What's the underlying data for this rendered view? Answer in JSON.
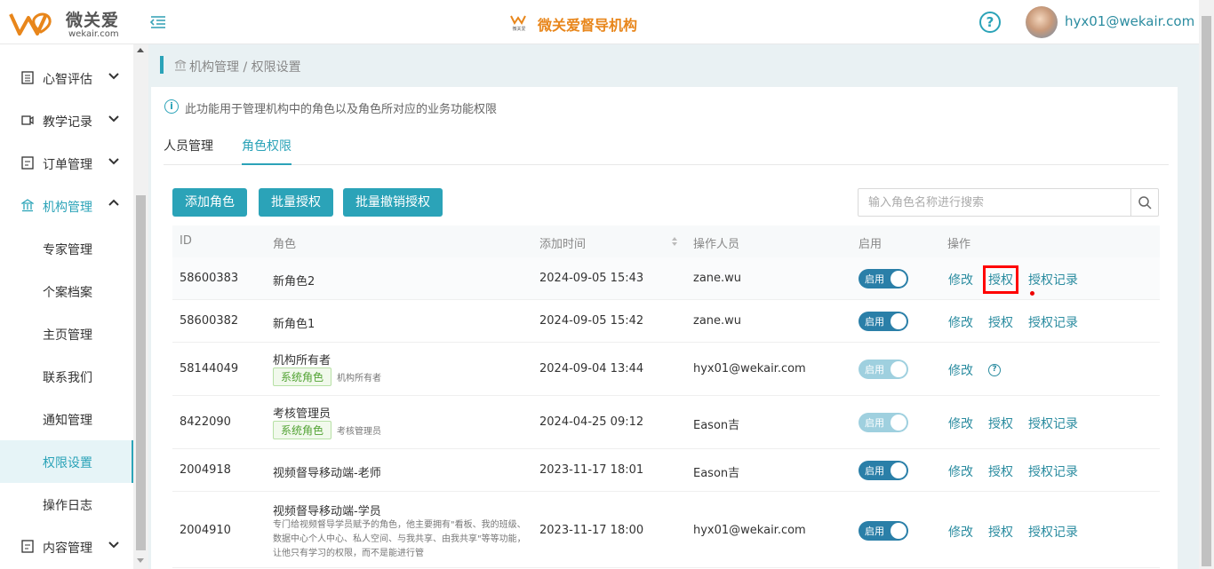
{
  "header": {
    "brand": "微关爱",
    "domain": "wekair.com",
    "mini_logo_text": "微关爱",
    "center_title": "微关爱督导机构",
    "help_glyph": "?",
    "user_email": "hyx01@wekair.com"
  },
  "sidebar": {
    "items": [
      {
        "label": "心智评估",
        "icon": "list-icon"
      },
      {
        "label": "教学记录",
        "icon": "video-icon"
      },
      {
        "label": "订单管理",
        "icon": "document-icon"
      },
      {
        "label": "机构管理",
        "icon": "bank-icon"
      },
      {
        "label": "内容管理",
        "icon": "document-icon"
      }
    ],
    "sub_items": [
      "专家管理",
      "个案档案",
      "主页管理",
      "联系我们",
      "通知管理",
      "权限设置",
      "操作日志"
    ],
    "active_sub": "权限设置"
  },
  "breadcrumb": {
    "text": "机构管理 / 权限设置"
  },
  "info": {
    "glyph": "i",
    "text": "此功能用于管理机构中的角色以及角色所对应的业务功能权限"
  },
  "tabs": [
    {
      "label": "人员管理",
      "active": false
    },
    {
      "label": "角色权限",
      "active": true
    }
  ],
  "toolbar": {
    "add_role": "添加角色",
    "batch_grant": "批量授权",
    "batch_revoke": "批量撤销授权",
    "search_placeholder": "输入角色名称进行搜索"
  },
  "table": {
    "headers": [
      "ID",
      "角色",
      "添加时间",
      "操作人员",
      "启用",
      "操作"
    ],
    "rows": [
      {
        "id": "58600383",
        "role": "新角色2",
        "time": "2024-09-05 15:43",
        "operator": "zane.wu",
        "enabled_label": "启用",
        "edit": "修改",
        "grant": "授权",
        "log": "授权记录"
      },
      {
        "id": "58600382",
        "role": "新角色1",
        "time": "2024-09-05 15:42",
        "operator": "zane.wu",
        "enabled_label": "启用",
        "edit": "修改",
        "grant": "授权",
        "log": "授权记录"
      },
      {
        "id": "58144049",
        "role": "机构所有者",
        "tag": "系统角色",
        "tag_note": "机构所有者",
        "time": "2024-09-04 13:44",
        "operator": "hyx01@wekair.com",
        "enabled_label": "启用",
        "edit": "修改",
        "help_glyph": "?"
      },
      {
        "id": "8422090",
        "role": "考核管理员",
        "tag": "系统角色",
        "tag_note": "考核管理员",
        "time": "2024-04-25 09:12",
        "operator": "Eason吉",
        "enabled_label": "启用",
        "edit": "修改",
        "grant": "授权",
        "log": "授权记录"
      },
      {
        "id": "2004918",
        "role": "视频督导移动端-老师",
        "time": "2023-11-17 18:01",
        "operator": "Eason吉",
        "enabled_label": "启用",
        "edit": "修改",
        "grant": "授权",
        "log": "授权记录"
      },
      {
        "id": "2004910",
        "role": "视频督导移动端-学员",
        "desc": "专门给视频督导学员赋予的角色，他主要拥有\"看板、我的班级、数据中心个人中心、私人空间、与我共享、由我共享\"等等功能，让他只有学习的权限，而不是能进行管",
        "time": "2023-11-17 18:00",
        "operator": "hyx01@wekair.com",
        "enabled_label": "启用",
        "edit": "修改",
        "grant": "授权",
        "log": "授权记录"
      }
    ]
  },
  "colors": {
    "accent": "#2ba3b8",
    "brand_orange": "#e8861b",
    "highlight_red": "#ff0000"
  }
}
